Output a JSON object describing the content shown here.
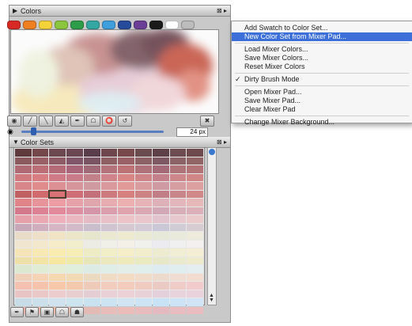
{
  "colors_panel": {
    "title": "Colors",
    "header_buttons": "⊠ ▸",
    "swatches": [
      "#d82a25",
      "#f07f22",
      "#f4d23a",
      "#8cc63f",
      "#2e9d49",
      "#35a7a3",
      "#3f9fdc",
      "#274b9b",
      "#6b3f96",
      "#1a1a1a",
      "#ffffff",
      "#bcbcbc"
    ],
    "tools": [
      "◉",
      "╱",
      "╲",
      "◭",
      "✒",
      "☖",
      "⭕",
      "↺"
    ],
    "trash_icon": "✖",
    "brush_size": "24 px"
  },
  "color_sets_panel": {
    "title": "Color Sets",
    "header_buttons": "⊠ ▸",
    "grid": [
      [
        "#5e3a3c",
        "#74484a",
        "#6c4850",
        "#6a4752",
        "#5a3d4a",
        "#6d474b",
        "#77494a",
        "#6a4c4e",
        "#5d4048",
        "#6d4d50",
        "#6e4a4c"
      ],
      [
        "#8a5a5f",
        "#996067",
        "#8e5c66",
        "#82566a",
        "#7a5462",
        "#8e5f63",
        "#9a6266",
        "#8d6266",
        "#7e5863",
        "#8c6468",
        "#916466"
      ],
      [
        "#b06a73",
        "#bc6e76",
        "#b56a78",
        "#a9667a",
        "#a06a78",
        "#b4727a",
        "#bd7276",
        "#b0727a",
        "#a46a78",
        "#ae7478",
        "#b27476"
      ],
      [
        "#d07a80",
        "#d87d82",
        "#cf7a86",
        "#c97b8a",
        "#c28088",
        "#d0838a",
        "#d88686",
        "#cf8588",
        "#c4808a",
        "#cd868a",
        "#d18686"
      ],
      [
        "#d8868a",
        "#e08c8c",
        "#dc9094",
        "#d6959a",
        "#cf9aa0",
        "#da999c",
        "#e19a98",
        "#d99da0",
        "#d09aa2",
        "#d79ea2",
        "#dca0a0"
      ],
      [
        "#c06063",
        "#d06a6c",
        "#d87275",
        "#cf6e76",
        "#c4707a",
        "#cc7a7e",
        "#d68080",
        "#cd8284",
        "#c27e86",
        "#c9868a",
        "#d08888"
      ],
      [
        "#e0848a",
        "#e6939a",
        "#ec9ea4",
        "#e6a2a8",
        "#dfa6ae",
        "#e6acb0",
        "#ecb0b0",
        "#e6b4b6",
        "#deb0b8",
        "#e2b6ba",
        "#e6b8b8"
      ],
      [
        "#d4788c",
        "#dc8294",
        "#e28a9c",
        "#dc90a2",
        "#d496a8",
        "#da9eac",
        "#e0a4ae",
        "#daa8b2",
        "#d2a8b6",
        "#d8aeb8",
        "#dcb0b8"
      ],
      [
        "#e6a0aa",
        "#eaa8b2",
        "#eeb0ba",
        "#eab6c0",
        "#e4bac4",
        "#e8c0c8",
        "#ecc4c8",
        "#e8c6cc",
        "#e2c4ce",
        "#e6c8ce",
        "#eacaca"
      ],
      [
        "#c8a8b8",
        "#d0aebe",
        "#d6b6c4",
        "#d2bac8",
        "#cabecc",
        "#d0c4d0",
        "#d6c8d0",
        "#d2cad4",
        "#cac8d6",
        "#d0ccd6",
        "#d6ccd2"
      ],
      [
        "#e8dcc8",
        "#eee0c8",
        "#f0e4c4",
        "#ece6c8",
        "#e6e6cc",
        "#eae8d0",
        "#eeead0",
        "#eaead4",
        "#e6e8d8",
        "#eaeadc",
        "#eeeadc"
      ],
      [
        "#f0e6d0",
        "#f4e8cc",
        "#f6ecc8",
        "#f2eecc",
        "#ecece4",
        "#f0f0e8",
        "#f4f0e8",
        "#f0f0ec",
        "#ececf0",
        "#f0f0f0",
        "#f4f0f0"
      ],
      [
        "#f4e4b8",
        "#f8e8b4",
        "#faecb0",
        "#f6eeb4",
        "#eeecc4",
        "#f2eec8",
        "#f6eec8",
        "#f2eecc",
        "#eeecd0",
        "#f2eed4",
        "#f4eed4"
      ],
      [
        "#ece0a8",
        "#f2e4a4",
        "#f6e8a0",
        "#f0eaa8",
        "#e6e6b8",
        "#eae8bc",
        "#eeeabc",
        "#eaeac0",
        "#e6e8c8",
        "#eaeacc",
        "#eeeacc"
      ],
      [
        "#dce8d0",
        "#e0ecd4",
        "#e4eed4",
        "#e0eedc",
        "#dcece4",
        "#e0eee8",
        "#e4eee8",
        "#e0eeec",
        "#dcecf0",
        "#e0eef0",
        "#e4eef0"
      ],
      [
        "#f0d0b8",
        "#f4d4b4",
        "#f6d8b0",
        "#f2dab4",
        "#ecdac0",
        "#f0dcc4",
        "#f4dcc4",
        "#f0dcc8",
        "#ecdacc",
        "#f0dcd0",
        "#f2dcd0"
      ],
      [
        "#f4c0b0",
        "#f6c4ac",
        "#f8c8a8",
        "#f4caac",
        "#eecab8",
        "#f2ccbc",
        "#f4ccbc",
        "#f0ccc0",
        "#eccac4",
        "#f0ccc8",
        "#f2cccc"
      ],
      [
        "#e8c4c4",
        "#eac8c8",
        "#eccccc",
        "#e8cece",
        "#e4ced4",
        "#e8d0d6",
        "#ecd2d6",
        "#e8d2d8",
        "#e4d0da",
        "#e8d2dc",
        "#ead2dc"
      ],
      [
        "#c8dce8",
        "#cce0ec",
        "#d0e2ee",
        "#cce4ee",
        "#c8e2f0",
        "#cce4f2",
        "#d0e4f2",
        "#cce4f4",
        "#c8e2f6",
        "#cce4f6",
        "#d0e4f6"
      ],
      [
        "#e8b0a8",
        "#eab4a8",
        "#ecb8a8",
        "#e8baac",
        "#e4bab4",
        "#e8bcb8",
        "#ecbcb8",
        "#e8bcbc",
        "#e4bac0",
        "#e8bcc0",
        "#eabcc0"
      ]
    ],
    "selected": {
      "row": 5,
      "col": 2
    },
    "bottom_buttons": [
      "✒",
      "⚑",
      "▣",
      "☖",
      "☗"
    ]
  },
  "context_menu": {
    "items": [
      {
        "label": "Add Swatch to Color Set...",
        "highlight": false,
        "checked": false
      },
      {
        "label": "New Color Set from Mixer Pad...",
        "highlight": true,
        "checked": false
      },
      {
        "sep": true
      },
      {
        "label": "Load Mixer Colors...",
        "highlight": false,
        "checked": false
      },
      {
        "label": "Save Mixer Colors...",
        "highlight": false,
        "checked": false
      },
      {
        "label": "Reset Mixer Colors",
        "highlight": false,
        "checked": false
      },
      {
        "sep": true
      },
      {
        "label": "Dirty Brush Mode",
        "highlight": false,
        "checked": true
      },
      {
        "sep": true
      },
      {
        "label": "Open Mixer Pad...",
        "highlight": false,
        "checked": false
      },
      {
        "label": "Save Mixer Pad...",
        "highlight": false,
        "checked": false
      },
      {
        "label": "Clear Mixer Pad",
        "highlight": false,
        "checked": false
      },
      {
        "sep": true
      },
      {
        "label": "Change Mixer Background...",
        "highlight": false,
        "checked": false
      }
    ],
    "check_glyph": "✓"
  }
}
